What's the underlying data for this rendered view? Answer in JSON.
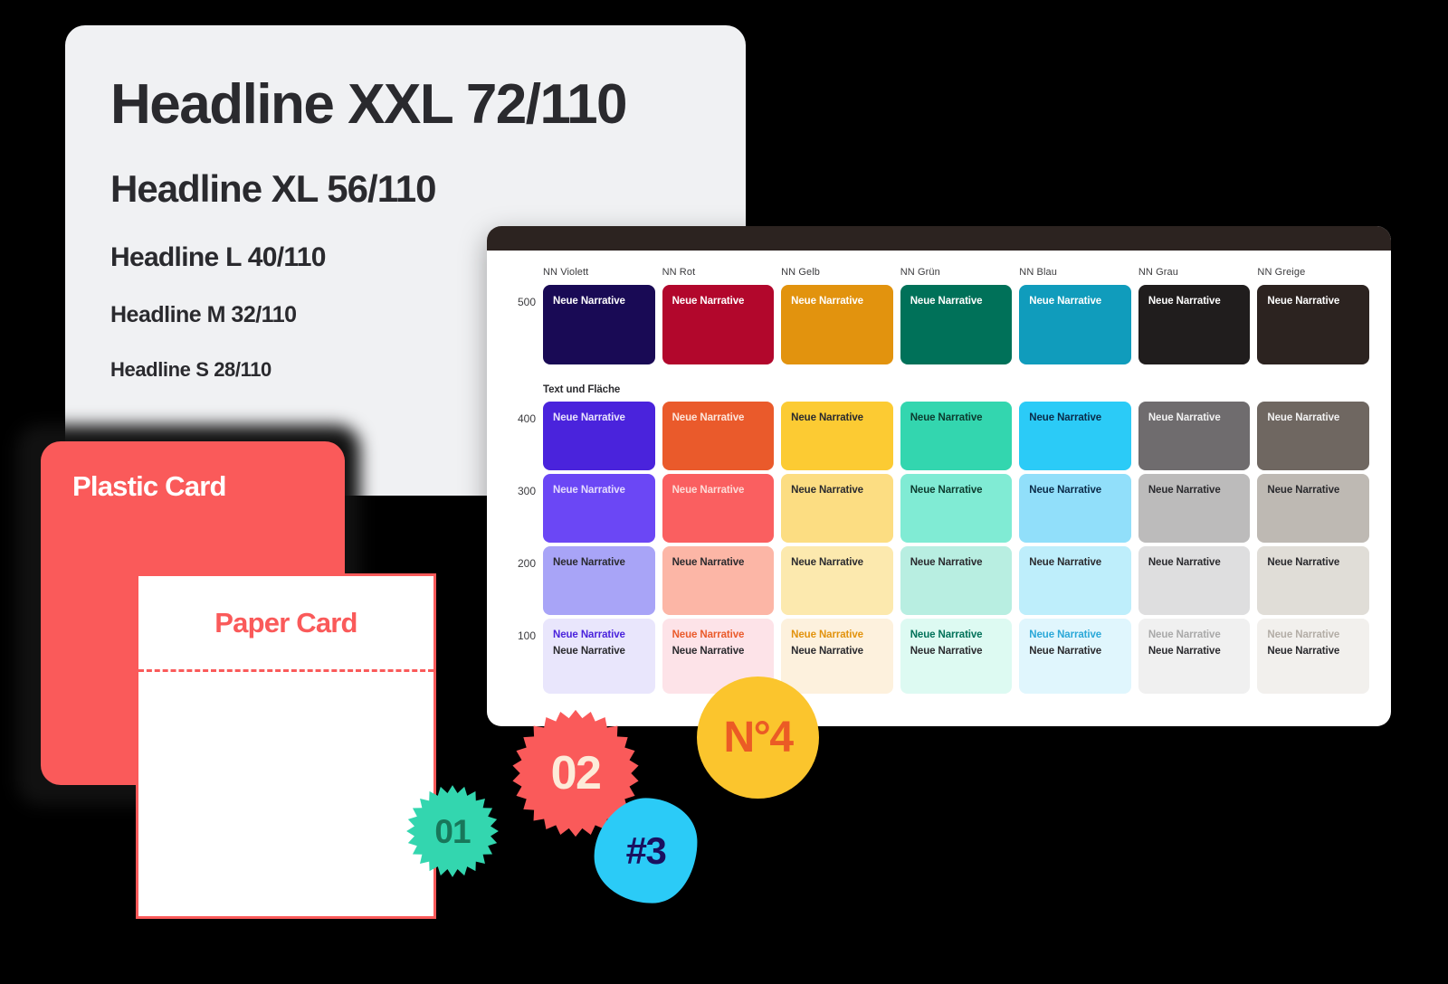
{
  "typography_card": {
    "name": "Typography scale card",
    "lines": [
      {
        "text": "Headline XXL 72/110",
        "size_class": "hl-xxl"
      },
      {
        "text": "Headline XL 56/110",
        "size_class": "hl-xl"
      },
      {
        "text": "Headline L 40/110",
        "size_class": "hl-l"
      },
      {
        "text": "Headline M 32/110",
        "size_class": "hl-m"
      },
      {
        "text": "Headline S 28/110",
        "size_class": "hl-s"
      }
    ]
  },
  "plastic_card": {
    "title": "Plastic Card",
    "bg": "#FA5A5A",
    "text_color": "#FFFFFF"
  },
  "paper_card": {
    "title": "Paper Card",
    "bg": "#FFFFFF",
    "text_color": "#FA5A5A",
    "border_color": "#FA5A5A"
  },
  "palette": {
    "titlebar_color": "#2C2320",
    "section_label": "Text und Fläche",
    "swatch_text": "Neue Narrative",
    "columns": [
      {
        "label": "NN Violett"
      },
      {
        "label": "NN Rot"
      },
      {
        "label": "NN Gelb"
      },
      {
        "label": "NN Grün"
      },
      {
        "label": "NN Blau"
      },
      {
        "label": "NN Grau"
      },
      {
        "label": "NN Greige"
      }
    ],
    "rows": [
      {
        "level": "500",
        "swatches": [
          {
            "bg": "#190A55",
            "fg": "#FFFFFF"
          },
          {
            "bg": "#B2072C",
            "fg": "#FFFFFF"
          },
          {
            "bg": "#E2930E",
            "fg": "#FFFFFF"
          },
          {
            "bg": "#007159",
            "fg": "#FFFFFF"
          },
          {
            "bg": "#109CBC",
            "fg": "#FFFFFF"
          },
          {
            "bg": "#201D1D",
            "fg": "#FFFFFF"
          },
          {
            "bg": "#2C2320",
            "fg": "#FFFFFF"
          }
        ]
      },
      {
        "level": "400",
        "swatches": [
          {
            "bg": "#4A23DC",
            "fg": "#E9E4FD"
          },
          {
            "bg": "#EA5A2B",
            "fg": "#FDE6DC"
          },
          {
            "bg": "#FCCB33",
            "fg": "#2A2A2E"
          },
          {
            "bg": "#33D6AF",
            "fg": "#0C3A2E"
          },
          {
            "bg": "#2BCBF7",
            "fg": "#0A2B49"
          },
          {
            "bg": "#6F6C6E",
            "fg": "#F2F2F2"
          },
          {
            "bg": "#6F6761",
            "fg": "#F2F2F2"
          }
        ]
      },
      {
        "level": "300",
        "swatches": [
          {
            "bg": "#6B47F5",
            "fg": "#E4DCFE"
          },
          {
            "bg": "#FA5F60",
            "fg": "#FDDCD8"
          },
          {
            "bg": "#FCDD82",
            "fg": "#2A2A2E"
          },
          {
            "bg": "#80EBD4",
            "fg": "#0C3A2E"
          },
          {
            "bg": "#91DFFA",
            "fg": "#0A2B49"
          },
          {
            "bg": "#BCBBBB",
            "fg": "#2A2A2E"
          },
          {
            "bg": "#BEB9B3",
            "fg": "#2A2A2E"
          }
        ]
      },
      {
        "level": "200",
        "swatches": [
          {
            "bg": "#A8A4F7",
            "fg": "#2A2A2E"
          },
          {
            "bg": "#FCB6A6",
            "fg": "#2A2A2E"
          },
          {
            "bg": "#FCE9AE",
            "fg": "#2A2A2E"
          },
          {
            "bg": "#B8EEE1",
            "fg": "#2A2A2E"
          },
          {
            "bg": "#BEEEFB",
            "fg": "#2A2A2E"
          },
          {
            "bg": "#DEDEDF",
            "fg": "#2A2A2E"
          },
          {
            "bg": "#E0DDD7",
            "fg": "#2A2A2E"
          }
        ]
      },
      {
        "level": "100",
        "swatches": [
          {
            "bg": "#E9E6FC",
            "fg": "#4A23DC",
            "fg2": "#2A2A2E"
          },
          {
            "bg": "#FDE3E8",
            "fg": "#EA5A2B",
            "fg2": "#2A2A2E"
          },
          {
            "bg": "#FDF1DD",
            "fg": "#E2930E",
            "fg2": "#2A2A2E"
          },
          {
            "bg": "#DDFAF2",
            "fg": "#007159",
            "fg2": "#2A2A2E"
          },
          {
            "bg": "#E0F6FD",
            "fg": "#2BA8D8",
            "fg2": "#2A2A2E"
          },
          {
            "bg": "#F0F0F0",
            "fg": "#A9A9A9",
            "fg2": "#2A2A2E"
          },
          {
            "bg": "#F2F0ED",
            "fg": "#B3ADA6",
            "fg2": "#2A2A2E"
          }
        ]
      }
    ]
  },
  "badges": [
    {
      "id": "01",
      "label": "01",
      "bg": "#33D6AF",
      "fg": "#18775A",
      "shape": "starburst"
    },
    {
      "id": "02",
      "label": "02",
      "bg": "#FA5A5A",
      "fg": "#FDEBD9",
      "shape": "starburst"
    },
    {
      "id": "03",
      "label": "#3",
      "bg": "#2BCBF7",
      "fg": "#1A1060",
      "shape": "blob"
    },
    {
      "id": "04",
      "label": "N°4",
      "bg": "#FBC52D",
      "fg": "#EB5B25",
      "shape": "circle"
    }
  ]
}
